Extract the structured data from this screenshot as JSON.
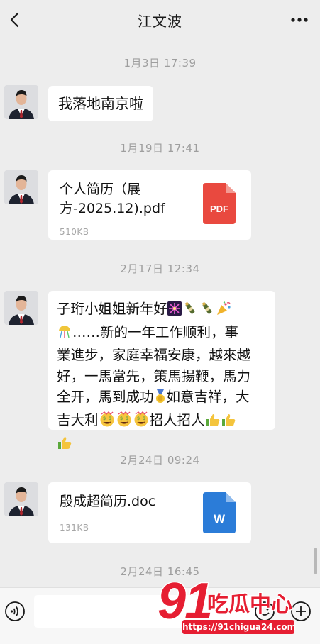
{
  "header": {
    "title": "江文波",
    "back_icon": "chevron-left-icon",
    "more_icon": "more-dots-icon"
  },
  "messages": [
    {
      "timestamp": "1月3日 17:39",
      "type": "text",
      "text": "我落地南京啦"
    },
    {
      "timestamp": "1月19日 17:41",
      "type": "file",
      "file_name": "个人简历（展\n方-2025.12).pdf",
      "file_size": "510KB",
      "file_icon": "pdf-icon",
      "file_icon_label": "PDF",
      "file_icon_color": "#e9493f"
    },
    {
      "timestamp": "2月17日 12:34",
      "type": "text",
      "text_lines": [
        "子珩小姐姐新年好",
        "……新的一年工作顺利，事",
        "業進步，家庭幸福安康，越來越",
        "好，一馬當先，策馬揚鞭，馬力",
        "全开，馬到成功",
        "如意吉祥，大",
        "吉大利",
        "招人招人"
      ],
      "emojis": [
        "fireworks-icon",
        "champagne-icon",
        "champagne-icon",
        "party-popper-icon",
        "confetti-ball-icon",
        "medal-icon",
        "money-mouth-face-icon",
        "money-mouth-face-icon",
        "money-mouth-face-icon",
        "thumbs-up-icon",
        "thumbs-up-icon",
        "thumbs-up-icon"
      ]
    },
    {
      "timestamp": "2月24日 09:24",
      "type": "file",
      "file_name": "殷成超简历.doc",
      "file_size": "131KB",
      "file_icon": "word-icon",
      "file_icon_label": "W",
      "file_icon_color": "#2b7cd8"
    },
    {
      "timestamp": "2月24日 16:45"
    }
  ],
  "input_bar": {
    "voice_icon": "voice-icon",
    "emoji_icon": "emoji-icon",
    "plus_icon": "plus-circle-icon"
  },
  "watermark": {
    "logo_text": "91吃瓜中心",
    "url": "https://91chigua24.com"
  },
  "colors": {
    "background": "#ededed",
    "bubble": "#ffffff",
    "timestamp": "#9e9e9e",
    "watermark": "#e61e32"
  }
}
